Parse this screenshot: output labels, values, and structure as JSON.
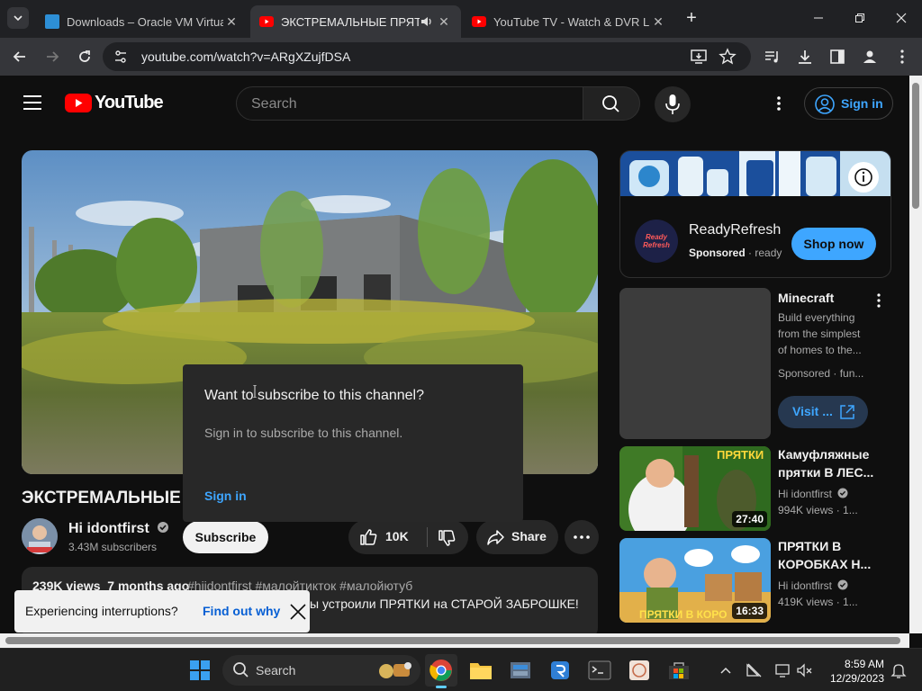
{
  "browser": {
    "tabs": [
      {
        "title": "Downloads – Oracle VM Virtual",
        "active": false
      },
      {
        "title": "ЭКСТРЕМАЛЬНЫЕ ПРЯТКИ",
        "active": true
      },
      {
        "title": "YouTube TV - Watch & DVR Live",
        "active": false
      }
    ],
    "url": "youtube.com/watch?v=ARgXZujfDSA"
  },
  "youtube": {
    "logo_text": "YouTube",
    "search_placeholder": "Search",
    "sign_in": "Sign in",
    "video_title": "ЭКСТРЕМАЛЬНЫЕ",
    "channel": {
      "name": "Hi idontfirst",
      "subscribers": "3.43M subscribers"
    },
    "subscribe_label": "Subscribe",
    "likes": "10K",
    "share_label": "Share",
    "description": {
      "stats": "239K views  7 months ago",
      "tags": "#hiidontfirst #малойтикток #малойютуб",
      "text": "ы устроили ПРЯТКИ на СТАРОЙ ЗАБРОШКЕ!"
    },
    "popup": {
      "title": "Want to subscribe to this channel?",
      "body": "Sign in to subscribe to this channel.",
      "link": "Sign in"
    },
    "toast": {
      "message": "Experiencing interruptions?",
      "action": "Find out why"
    },
    "ad": {
      "name": "ReadyRefresh",
      "sponsored": "Sponsored",
      "domain": "ready",
      "cta": "Shop now",
      "logo_text": "Ready Refresh"
    },
    "recommendations": [
      {
        "title": "Minecraft",
        "desc": "Build everything from the simplest of homes to the...",
        "meta": "Sponsored · fun...",
        "cta": "Visit ..."
      },
      {
        "title": "Камуфляжные прятки В ЛЕС...",
        "channel": "Hi idontfirst",
        "meta": "994K views · 1...",
        "duration": "27:40",
        "thumb_text": "ПРЯТКИ"
      },
      {
        "title": "ПРЯТКИ В КОРОБКАХ Н...",
        "channel": "Hi idontfirst",
        "meta": "419K views · 1...",
        "duration": "16:33",
        "thumb_text": "ПРЯТКИ В КОРО"
      }
    ]
  },
  "taskbar": {
    "search_label": "Search",
    "time": "8:59 AM",
    "date": "12/29/2023"
  },
  "colors": {
    "accent_blue": "#3ea6ff",
    "youtube_red": "#ff0000",
    "ad_button": "#3ea6ff"
  }
}
